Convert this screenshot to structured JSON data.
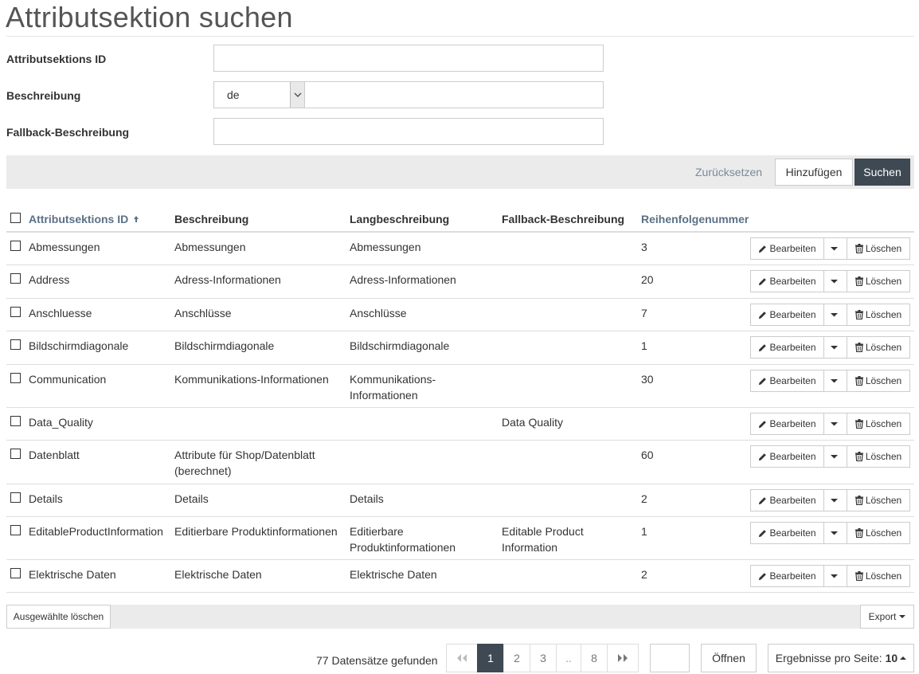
{
  "page": {
    "title": "Attributsektion suchen"
  },
  "form": {
    "id_label": "Attributsektions ID",
    "id_value": "",
    "desc_label": "Beschreibung",
    "desc_lang": "de",
    "desc_value": "",
    "fallback_label": "Fallback-Beschreibung",
    "fallback_value": ""
  },
  "toolbar": {
    "reset": "Zurücksetzen",
    "add": "Hinzufügen",
    "search": "Suchen"
  },
  "table": {
    "headers": {
      "id": "Attributsektions ID",
      "desc": "Beschreibung",
      "long": "Langbeschreibung",
      "fallback": "Fallback-Beschreibung",
      "order": "Reihenfolgenummer"
    },
    "sort_column": "id",
    "sort_direction": "ascending",
    "actions": {
      "edit": "Bearbeiten",
      "delete": "Löschen"
    },
    "rows": [
      {
        "id": "Abmessungen",
        "desc": "Abmessungen",
        "long": "Abmessungen",
        "fallback": "",
        "order": "3"
      },
      {
        "id": "Address",
        "desc": "Adress-Informationen",
        "long": "Adress-Informationen",
        "fallback": "",
        "order": "20"
      },
      {
        "id": "Anschluesse",
        "desc": "Anschlüsse",
        "long": "Anschlüsse",
        "fallback": "",
        "order": "7"
      },
      {
        "id": "Bildschirmdiagonale",
        "desc": "Bildschirmdiagonale",
        "long": "Bildschirmdiagonale",
        "fallback": "",
        "order": "1"
      },
      {
        "id": "Communication",
        "desc": "Kommunikations-Informationen",
        "long": "Kommunikations-Informationen",
        "fallback": "",
        "order": "30"
      },
      {
        "id": "Data_Quality",
        "desc": "",
        "long": "",
        "fallback": "Data Quality",
        "order": ""
      },
      {
        "id": "Datenblatt",
        "desc": "Attribute für Shop/Datenblatt (berechnet)",
        "long": "",
        "fallback": "",
        "order": "60"
      },
      {
        "id": "Details",
        "desc": "Details",
        "long": "Details",
        "fallback": "",
        "order": "2"
      },
      {
        "id": "EditableProductInformation",
        "desc": "Editierbare Produktinformationen",
        "long": "Editierbare Produktinformationen",
        "fallback": "Editable Product Information",
        "order": "1"
      },
      {
        "id": "Elektrische Daten",
        "desc": "Elektrische Daten",
        "long": "Elektrische Daten",
        "fallback": "",
        "order": "2"
      }
    ]
  },
  "footer": {
    "delete_selected": "Ausgewählte löschen",
    "export": "Export"
  },
  "pagination": {
    "records": "77 Datensätze gefunden",
    "pages": [
      "1",
      "2",
      "3",
      "..",
      "8"
    ],
    "current": "1",
    "open": "Öffnen",
    "per_page_label": "Ergebnisse pro Seite:",
    "per_page_value": "10"
  },
  "icons": {
    "sort": "arrow-up-icon",
    "select": "chevron-down-icon",
    "edit": "pencil-icon",
    "delete": "trash-icon",
    "first": "double-chevron-left-icon",
    "last": "double-chevron-right-icon"
  },
  "colors": {
    "accent_dark": "#3e4953",
    "header_link": "#5b7086",
    "toolbar_bg": "#ebebeb"
  }
}
